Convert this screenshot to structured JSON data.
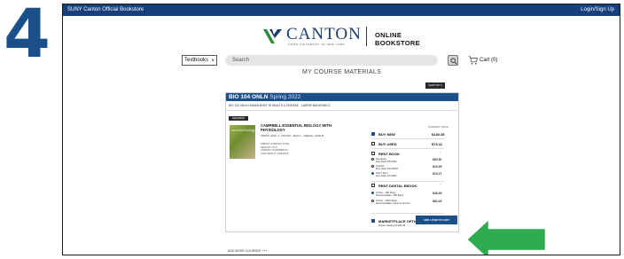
{
  "step_number": "4",
  "topbar": {
    "left": "SUNY Canton Official Bookstore",
    "right": "Login/Sign Up"
  },
  "logo": {
    "name": "CANTON",
    "subtitle": "STATE UNIVERSITY OF NEW YORK",
    "store": "ONLINE BOOKSTORE"
  },
  "search": {
    "category": "Textbooks",
    "placeholder": "Search",
    "cart_label": "Cart (0)"
  },
  "page_title": "MY COURSE MATERIALS",
  "sort_label": "SORT BY",
  "course": {
    "code": "BIO 104 ONLN",
    "term": "Spring 2022",
    "subtitle": "BIO 104 ONLN HUMAN BODY IN HEALTH & DISEASE - CARRIE MANKOWICZ"
  },
  "item": {
    "badge": "REQUIRED",
    "cover_text": "essential biology",
    "title": "CAMPBELL ESSENTIAL BIOLOGY WITH PHYSIOLOGY",
    "authors": "SIMON, ERIC J., DICKEY, JEAN L., REECE, JANE B.",
    "meta": [
      "ISBN13: 9780134711751",
      "EDITION: 6TH",
      "FORMAT: PAPERBACK",
      "COPYRIGHT: 1/30/2018"
    ],
    "price_header": "CURRENT PRICE",
    "options": [
      {
        "label": "BUY NEW",
        "price": "$130.35",
        "checked": true
      },
      {
        "label": "BUY USED",
        "price": "$73.11",
        "checked": false
      },
      {
        "label": "RENT BOOK",
        "price": "",
        "checked": false
      },
      {
        "label": "RENT DIGITAL EBOOK",
        "price": "",
        "checked": false
      },
      {
        "label": "MARKETPLACE OPTIONS",
        "price": "",
        "checked": true
      }
    ],
    "rent_subs": [
      {
        "name": "Semester",
        "due": "Due back 5/5/2022",
        "price": "$60.50"
      },
      {
        "name": "Quarter",
        "due": "Due back 2/14/2022",
        "price": "$19.09"
      },
      {
        "name": "Short Term",
        "due": "Due back 1/7/2022",
        "price": "$10.27"
      }
    ],
    "ebook_subs": [
      {
        "name": "Online - 180 Days",
        "due": "Downloadable: 180 Days",
        "price": "$49.49"
      },
      {
        "name": "Online - 1825 Days",
        "due": "Downloadable: Lifetime Access",
        "price": "$62.49"
      }
    ],
    "marketplace_note": "Prices starting at $45.45"
  },
  "add_button": "ADD 1 ITEM TO CART",
  "add_more": "ADD MORE COURSES +++",
  "colors": {
    "brand": "#1b4f8a",
    "arrow": "#2eaa4f"
  }
}
